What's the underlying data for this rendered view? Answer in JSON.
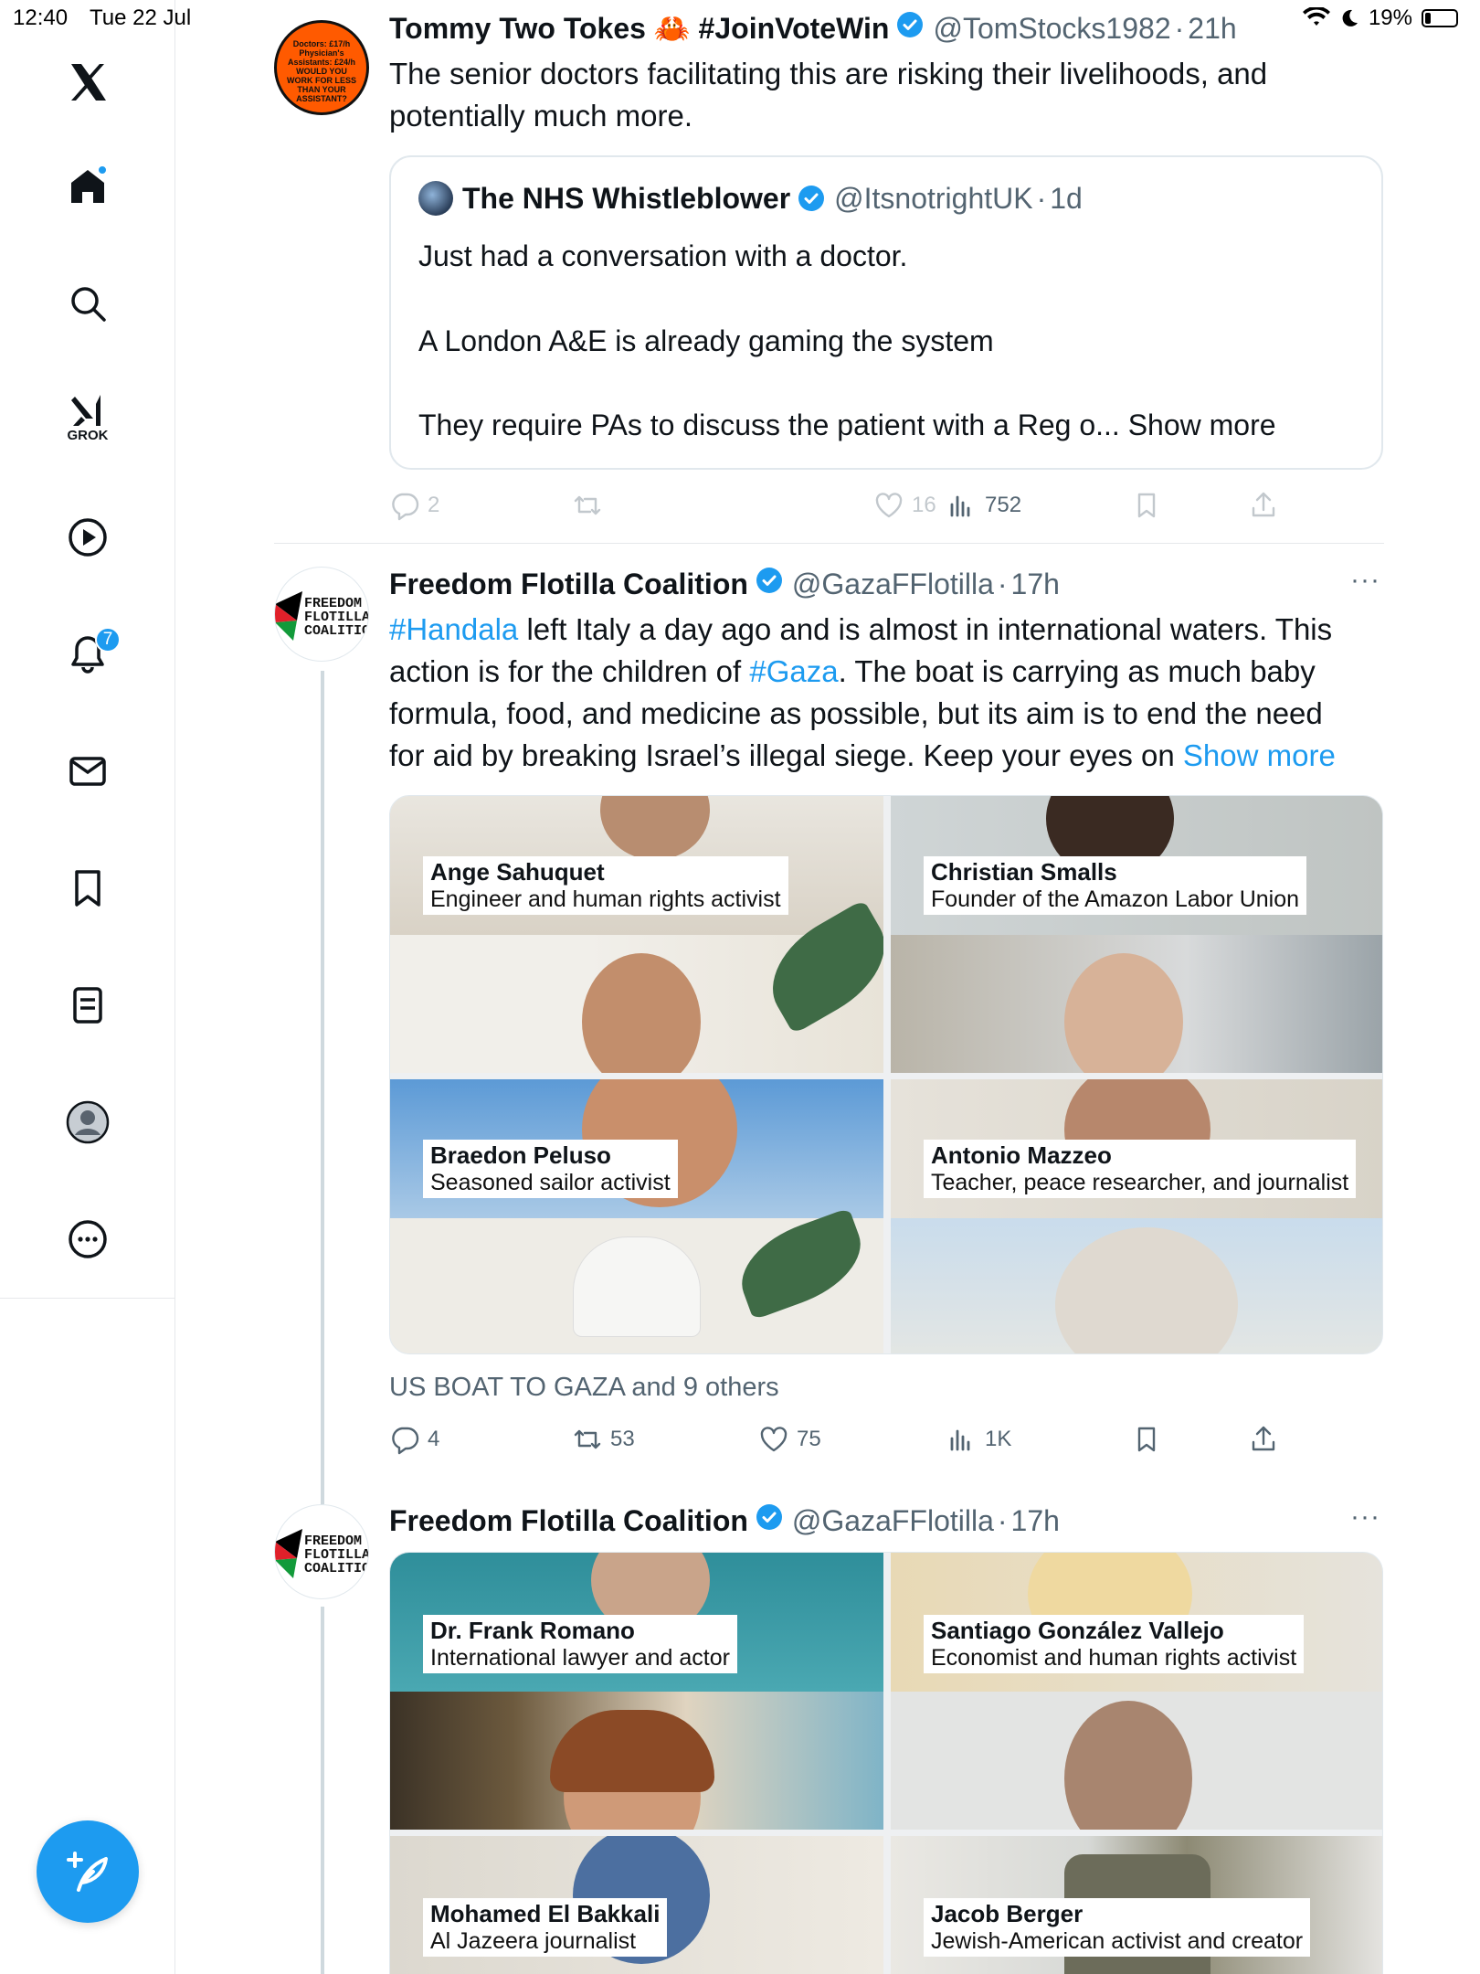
{
  "status_bar": {
    "time": "12:40",
    "date": "Tue 22 Jul",
    "battery": "19%"
  },
  "sidebar": {
    "grok_label": "GROK",
    "notifications_count": "7"
  },
  "tweet1": {
    "name": "Tommy Two Tokes 🦀 #JoinVoteWin",
    "handle": "@TomStocks1982",
    "time": "21h",
    "avatar_text": "Doctors: £17/h Physician's Assistants: £24/h WOULD YOU WORK FOR LESS THAN YOUR ASSISTANT?",
    "text_line1": "The senior doctors facilitating this are risking their livelihoods, and",
    "text_line2": "potentially much more.",
    "quote": {
      "name": "The NHS Whistleblower",
      "handle": "@ItsnotrightUK",
      "time": "1d",
      "line1": "Just had a conversation with a doctor.",
      "line2": "A London A&E is already gaming the system",
      "line3": "They require PAs to discuss the patient with a Reg o... Show more"
    },
    "replies": "2",
    "likes": "16",
    "views": "752"
  },
  "tweet2": {
    "name": "Freedom Flotilla Coalition",
    "handle": "@GazaFFlotilla",
    "time": "17h",
    "avatar_text": "FREEDOM FLOTILLA COALITION",
    "text": {
      "l1_link": "#Handala",
      "l1_rest": " left Italy a day ago and is almost in international waters. This",
      "l2_a": "action is for the children of ",
      "l2_link": "#Gaza",
      "l2_b": ". The boat is carrying as much baby",
      "l3": "formula, food, and medicine as possible, but its aim is to end the need",
      "l4": "for aid by breaking Israel’s illegal siege. Keep your eyes on ",
      "show_more": "Show more"
    },
    "media": [
      {
        "name": "Ange Sahuquet",
        "role": "Engineer and human rights activist"
      },
      {
        "name": "Christian Smalls",
        "role": "Founder of the Amazon Labor Union"
      },
      {
        "name": "Braedon Peluso",
        "role": "Seasoned sailor activist"
      },
      {
        "name": "Antonio Mazzeo",
        "role": "Teacher, peace researcher, and journalist"
      }
    ],
    "tagged": "US BOAT TO GAZA and 9 others",
    "replies": "4",
    "reposts": "53",
    "likes": "75",
    "views": "1K"
  },
  "tweet3": {
    "name": "Freedom Flotilla Coalition",
    "handle": "@GazaFFlotilla",
    "time": "17h",
    "media": [
      {
        "name": "Dr. Frank Romano",
        "role": "International lawyer and actor"
      },
      {
        "name": "Santiago González Vallejo",
        "role": "Economist and human rights activist"
      },
      {
        "name": "Mohamed El Bakkali",
        "role": "Al Jazeera journalist"
      },
      {
        "name": "Jacob Berger",
        "role": "Jewish-American activist and creator"
      }
    ]
  },
  "colors": {
    "accent": "#1d9bf0",
    "text": "#0f1419",
    "muted": "#536471",
    "border": "#e6e8eb"
  }
}
